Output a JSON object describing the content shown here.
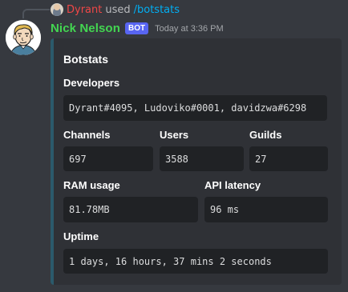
{
  "reply": {
    "user": "Dyrant",
    "action": "used",
    "command": "/botstats"
  },
  "message": {
    "author": "Nick Nelson",
    "bot_tag": "BOT",
    "timestamp": "Today at 3:36 PM",
    "name_color": "#43d651",
    "embed_color": "#2b5a6b"
  },
  "embed": {
    "title": "Botstats",
    "developers": {
      "name": "Developers",
      "value": "Dyrant#4095, Ludoviko#0001, davidzwa#6298"
    },
    "channels": {
      "name": "Channels",
      "value": "697"
    },
    "users": {
      "name": "Users",
      "value": "3588"
    },
    "guilds": {
      "name": "Guilds",
      "value": "27"
    },
    "ram": {
      "name": "RAM usage",
      "value": "81.78MB"
    },
    "latency": {
      "name": "API latency",
      "value": "96 ms"
    },
    "uptime": {
      "name": "Uptime",
      "value": "1 days, 16 hours, 37 mins 2 seconds"
    }
  }
}
